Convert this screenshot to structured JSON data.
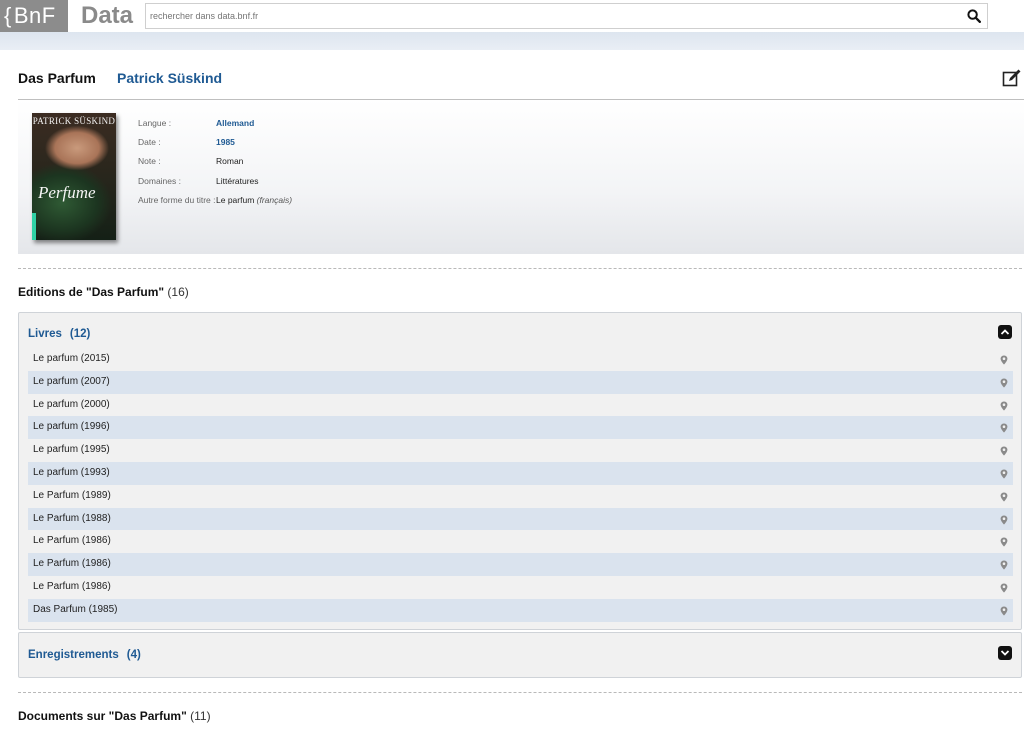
{
  "header": {
    "logo_brand": "BnF",
    "logo_product": "Data",
    "search_placeholder": "rechercher dans data.bnf.fr",
    "search_icon": "search-icon"
  },
  "work": {
    "title": "Das Parfum",
    "author": "Patrick Süskind",
    "cover": {
      "author_text": "PATRICK SÜSKIND",
      "title_text": "Perfume"
    },
    "meta": [
      {
        "label": "Langue :",
        "value": "Allemand",
        "link": true
      },
      {
        "label": "Date :",
        "value": "1985",
        "link": true
      },
      {
        "label": "Note :",
        "value": "Roman",
        "link": false
      },
      {
        "label": "Domaines :",
        "value": "Littératures",
        "link": false
      },
      {
        "label": "Autre forme du titre :",
        "value": "Le parfum",
        "extra": "(français)",
        "link": false
      }
    ]
  },
  "editions": {
    "heading": "Editions de \"Das Parfum\"",
    "count": "(16)",
    "livres": {
      "label": "Livres",
      "count": "(12)",
      "items": [
        "Le parfum (2015)",
        "Le parfum (2007)",
        "Le parfum (2000)",
        "Le parfum (1996)",
        "Le parfum (1995)",
        "Le parfum (1993)",
        "Le Parfum (1989)",
        "Le Parfum (1988)",
        "Le Parfum (1986)",
        "Le Parfum (1986)",
        "Le Parfum (1986)",
        "Das Parfum (1985)"
      ]
    },
    "enregistrements": {
      "label": "Enregistrements",
      "count": "(4)"
    }
  },
  "documents": {
    "heading": "Documents sur \"Das Parfum\"",
    "count": "(11)"
  },
  "colors": {
    "link": "#1f5a93",
    "row_alt": "#dae3ee",
    "logo_bg": "#8c8c8c"
  }
}
